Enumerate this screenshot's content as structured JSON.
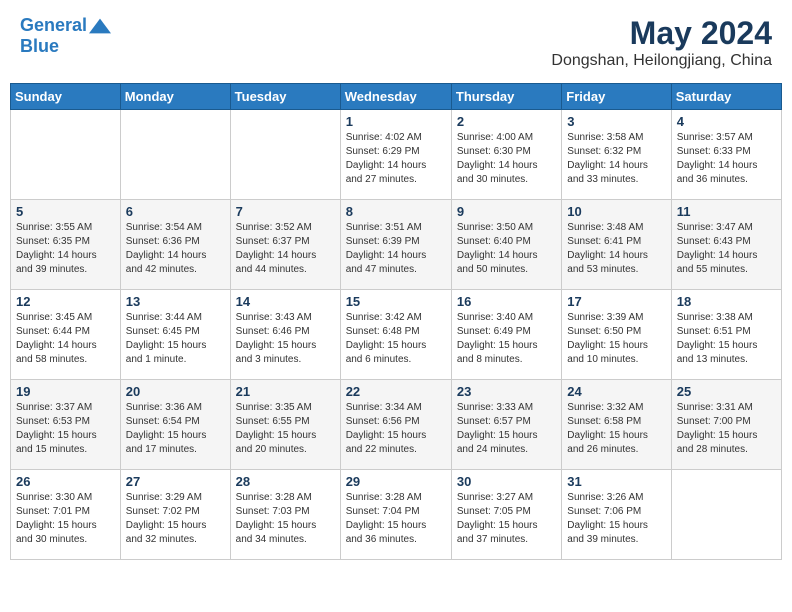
{
  "header": {
    "logo_line1": "General",
    "logo_line2": "Blue",
    "main_title": "May 2024",
    "subtitle": "Dongshan, Heilongjiang, China"
  },
  "days_of_week": [
    "Sunday",
    "Monday",
    "Tuesday",
    "Wednesday",
    "Thursday",
    "Friday",
    "Saturday"
  ],
  "weeks": [
    [
      {
        "day": "",
        "info": ""
      },
      {
        "day": "",
        "info": ""
      },
      {
        "day": "",
        "info": ""
      },
      {
        "day": "1",
        "info": "Sunrise: 4:02 AM\nSunset: 6:29 PM\nDaylight: 14 hours\nand 27 minutes."
      },
      {
        "day": "2",
        "info": "Sunrise: 4:00 AM\nSunset: 6:30 PM\nDaylight: 14 hours\nand 30 minutes."
      },
      {
        "day": "3",
        "info": "Sunrise: 3:58 AM\nSunset: 6:32 PM\nDaylight: 14 hours\nand 33 minutes."
      },
      {
        "day": "4",
        "info": "Sunrise: 3:57 AM\nSunset: 6:33 PM\nDaylight: 14 hours\nand 36 minutes."
      }
    ],
    [
      {
        "day": "5",
        "info": "Sunrise: 3:55 AM\nSunset: 6:35 PM\nDaylight: 14 hours\nand 39 minutes."
      },
      {
        "day": "6",
        "info": "Sunrise: 3:54 AM\nSunset: 6:36 PM\nDaylight: 14 hours\nand 42 minutes."
      },
      {
        "day": "7",
        "info": "Sunrise: 3:52 AM\nSunset: 6:37 PM\nDaylight: 14 hours\nand 44 minutes."
      },
      {
        "day": "8",
        "info": "Sunrise: 3:51 AM\nSunset: 6:39 PM\nDaylight: 14 hours\nand 47 minutes."
      },
      {
        "day": "9",
        "info": "Sunrise: 3:50 AM\nSunset: 6:40 PM\nDaylight: 14 hours\nand 50 minutes."
      },
      {
        "day": "10",
        "info": "Sunrise: 3:48 AM\nSunset: 6:41 PM\nDaylight: 14 hours\nand 53 minutes."
      },
      {
        "day": "11",
        "info": "Sunrise: 3:47 AM\nSunset: 6:43 PM\nDaylight: 14 hours\nand 55 minutes."
      }
    ],
    [
      {
        "day": "12",
        "info": "Sunrise: 3:45 AM\nSunset: 6:44 PM\nDaylight: 14 hours\nand 58 minutes."
      },
      {
        "day": "13",
        "info": "Sunrise: 3:44 AM\nSunset: 6:45 PM\nDaylight: 15 hours\nand 1 minute."
      },
      {
        "day": "14",
        "info": "Sunrise: 3:43 AM\nSunset: 6:46 PM\nDaylight: 15 hours\nand 3 minutes."
      },
      {
        "day": "15",
        "info": "Sunrise: 3:42 AM\nSunset: 6:48 PM\nDaylight: 15 hours\nand 6 minutes."
      },
      {
        "day": "16",
        "info": "Sunrise: 3:40 AM\nSunset: 6:49 PM\nDaylight: 15 hours\nand 8 minutes."
      },
      {
        "day": "17",
        "info": "Sunrise: 3:39 AM\nSunset: 6:50 PM\nDaylight: 15 hours\nand 10 minutes."
      },
      {
        "day": "18",
        "info": "Sunrise: 3:38 AM\nSunset: 6:51 PM\nDaylight: 15 hours\nand 13 minutes."
      }
    ],
    [
      {
        "day": "19",
        "info": "Sunrise: 3:37 AM\nSunset: 6:53 PM\nDaylight: 15 hours\nand 15 minutes."
      },
      {
        "day": "20",
        "info": "Sunrise: 3:36 AM\nSunset: 6:54 PM\nDaylight: 15 hours\nand 17 minutes."
      },
      {
        "day": "21",
        "info": "Sunrise: 3:35 AM\nSunset: 6:55 PM\nDaylight: 15 hours\nand 20 minutes."
      },
      {
        "day": "22",
        "info": "Sunrise: 3:34 AM\nSunset: 6:56 PM\nDaylight: 15 hours\nand 22 minutes."
      },
      {
        "day": "23",
        "info": "Sunrise: 3:33 AM\nSunset: 6:57 PM\nDaylight: 15 hours\nand 24 minutes."
      },
      {
        "day": "24",
        "info": "Sunrise: 3:32 AM\nSunset: 6:58 PM\nDaylight: 15 hours\nand 26 minutes."
      },
      {
        "day": "25",
        "info": "Sunrise: 3:31 AM\nSunset: 7:00 PM\nDaylight: 15 hours\nand 28 minutes."
      }
    ],
    [
      {
        "day": "26",
        "info": "Sunrise: 3:30 AM\nSunset: 7:01 PM\nDaylight: 15 hours\nand 30 minutes."
      },
      {
        "day": "27",
        "info": "Sunrise: 3:29 AM\nSunset: 7:02 PM\nDaylight: 15 hours\nand 32 minutes."
      },
      {
        "day": "28",
        "info": "Sunrise: 3:28 AM\nSunset: 7:03 PM\nDaylight: 15 hours\nand 34 minutes."
      },
      {
        "day": "29",
        "info": "Sunrise: 3:28 AM\nSunset: 7:04 PM\nDaylight: 15 hours\nand 36 minutes."
      },
      {
        "day": "30",
        "info": "Sunrise: 3:27 AM\nSunset: 7:05 PM\nDaylight: 15 hours\nand 37 minutes."
      },
      {
        "day": "31",
        "info": "Sunrise: 3:26 AM\nSunset: 7:06 PM\nDaylight: 15 hours\nand 39 minutes."
      },
      {
        "day": "",
        "info": ""
      }
    ]
  ]
}
